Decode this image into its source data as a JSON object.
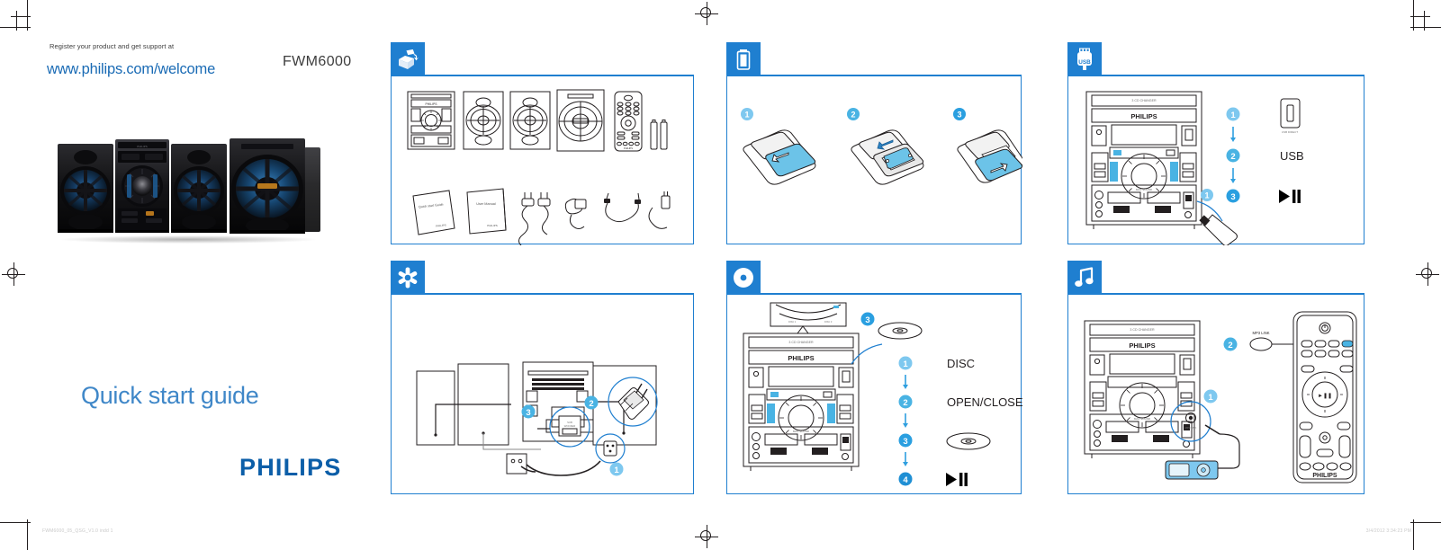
{
  "document": {
    "register_line": "Register your product and get support at",
    "web_url": "www.philips.com/welcome",
    "model": "FWM6000",
    "title": "Quick start guide",
    "brand": "PHILIPS",
    "footer_left": "FWM6000_05_QSG_V1.0 indd   1",
    "footer_right": "3/4/2012   3:34:23 PM",
    "accent_blue": "#1f7fd0",
    "step_blue": "#7ec8ef",
    "link_blue": "#1a6bb5",
    "title_blue": "#3f87c8"
  },
  "panels": {
    "unboxing": {
      "tab_icon": "open-box-icon",
      "items": [
        {
          "name": "main-unit",
          "label": ""
        },
        {
          "name": "speaker-left",
          "label": ""
        },
        {
          "name": "speaker-right",
          "label": ""
        },
        {
          "name": "subwoofer",
          "label": ""
        },
        {
          "name": "remote-control",
          "label": ""
        },
        {
          "name": "batteries",
          "label": ""
        },
        {
          "name": "quick-start-guide-booklet",
          "label": "Quick start Guide"
        },
        {
          "name": "user-manual-booklet",
          "label": "User Manual"
        },
        {
          "name": "power-cord",
          "label": ""
        },
        {
          "name": "fm-antenna",
          "label": ""
        },
        {
          "name": "audio-cable",
          "label": ""
        },
        {
          "name": "speaker-cable",
          "label": ""
        }
      ],
      "booklet_brand": "PHILIPS"
    },
    "battery": {
      "tab_icon": "battery-icon",
      "steps": [
        {
          "number": "1",
          "action": "slide-cover-open"
        },
        {
          "number": "2",
          "action": "insert-batteries"
        },
        {
          "number": "3",
          "action": "slide-cover-closed"
        }
      ]
    },
    "usb": {
      "tab_icon": "usb-icon",
      "tab_label": "USB",
      "unit_brand": "PHILIPS",
      "unit_top_label": "3 CD CHANGER",
      "port_caption": "USB DIRECT",
      "steps": [
        {
          "number": "1",
          "label": "",
          "icon": "usb-port-icon"
        },
        {
          "number": "2",
          "label": "USB",
          "icon": ""
        },
        {
          "number": "3",
          "label": "",
          "icon": "play-pause-icon"
        }
      ],
      "callout_number": "1"
    },
    "setup": {
      "tab_icon": "asterisk-gear-icon",
      "steps": [
        {
          "number": "1",
          "action": "connect-power-cord"
        },
        {
          "number": "2",
          "action": "connect-speaker-wires"
        },
        {
          "number": "3",
          "action": "connect-subwoofer"
        }
      ]
    },
    "disc": {
      "tab_icon": "disc-icon",
      "unit_brand": "PHILIPS",
      "unit_top_label": "3 CD CHANGER",
      "steps": [
        {
          "number": "1",
          "label": "DISC",
          "icon": ""
        },
        {
          "number": "2",
          "label": "OPEN/CLOSE",
          "icon": ""
        },
        {
          "number": "3",
          "label": "",
          "icon": "disc-icon"
        },
        {
          "number": "4",
          "label": "",
          "icon": "play-pause-icon"
        }
      ],
      "tray_callout": "3"
    },
    "mp3link": {
      "tab_icon": "music-note-icon",
      "unit_brand": "PHILIPS",
      "unit_top_label": "3 CD CHANGER",
      "remote_brand": "PHILIPS",
      "jack_caption": "MP3 LINK",
      "button_label": "MP3 LINK",
      "steps": [
        {
          "number": "1",
          "action": "plug-cable-into-mp3-link-jack"
        },
        {
          "number": "2",
          "action": "press-mp3-link-button"
        }
      ]
    }
  }
}
